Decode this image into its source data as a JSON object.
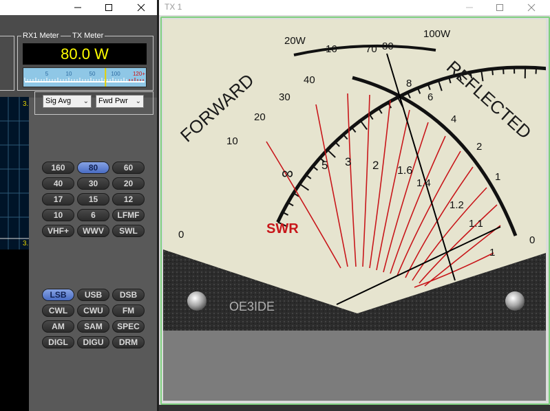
{
  "main_window": {
    "controls": {
      "minimize": "minimize-icon",
      "maximize": "maximize-icon",
      "close": "close-icon"
    },
    "meter": {
      "rx_label": "RX1 Meter",
      "tx_label": "TX Meter",
      "reading": "80.0 W",
      "scale_labels": [
        "5",
        "10",
        "50",
        "100",
        "120+"
      ],
      "scale_color": "#2c6aa0",
      "over_color": "#d01010",
      "needle_fraction": 0.58
    },
    "rx_select": {
      "value": "Sig Avg"
    },
    "tx_select": {
      "value": "Fwd Pwr"
    },
    "panadapter": {
      "top_freq": "3.",
      "bottom_freq": "3."
    },
    "bands": [
      {
        "label": "160",
        "active": false
      },
      {
        "label": "80",
        "active": true
      },
      {
        "label": "60",
        "active": false
      },
      {
        "label": "40",
        "active": false
      },
      {
        "label": "30",
        "active": false
      },
      {
        "label": "20",
        "active": false
      },
      {
        "label": "17",
        "active": false
      },
      {
        "label": "15",
        "active": false
      },
      {
        "label": "12",
        "active": false
      },
      {
        "label": "10",
        "active": false
      },
      {
        "label": "6",
        "active": false
      },
      {
        "label": "LFMF",
        "active": false
      },
      {
        "label": "VHF+",
        "active": false
      },
      {
        "label": "WWV",
        "active": false
      },
      {
        "label": "SWL",
        "active": false
      }
    ],
    "modes": [
      {
        "label": "LSB",
        "active": true
      },
      {
        "label": "USB",
        "active": false
      },
      {
        "label": "DSB",
        "active": false
      },
      {
        "label": "CWL",
        "active": false
      },
      {
        "label": "CWU",
        "active": false
      },
      {
        "label": "FM",
        "active": false
      },
      {
        "label": "AM",
        "active": false
      },
      {
        "label": "SAM",
        "active": false
      },
      {
        "label": "SPEC",
        "active": false
      },
      {
        "label": "DIGL",
        "active": false
      },
      {
        "label": "DIGU",
        "active": false
      },
      {
        "label": "DRM",
        "active": false
      }
    ]
  },
  "tx_window": {
    "title": "TX 1",
    "controls": {
      "minimize": "minimize-icon",
      "maximize": "maximize-icon",
      "close": "close-icon"
    },
    "cross_needle_meter": {
      "forward_label": "FORWARD",
      "reflected_label": "REFLECTED",
      "swr_label": "SWR",
      "brand": "OE3IDE",
      "forward_scale": [
        "0",
        "10",
        "20",
        "30",
        "40",
        "70",
        "80",
        "100W"
      ],
      "forward_top": [
        "20W",
        "16"
      ],
      "reflected_scale": [
        "8",
        "6",
        "4",
        "2",
        "1",
        "0"
      ],
      "swr_values": [
        "∞",
        "5",
        "3",
        "2",
        "1.6",
        "1.4",
        "1.2",
        "1.1",
        "1"
      ],
      "swr_color": "#c8161a",
      "face_color": "#e6e4cf",
      "forward_watts": 80,
      "reflected_watts": 0.5
    }
  }
}
